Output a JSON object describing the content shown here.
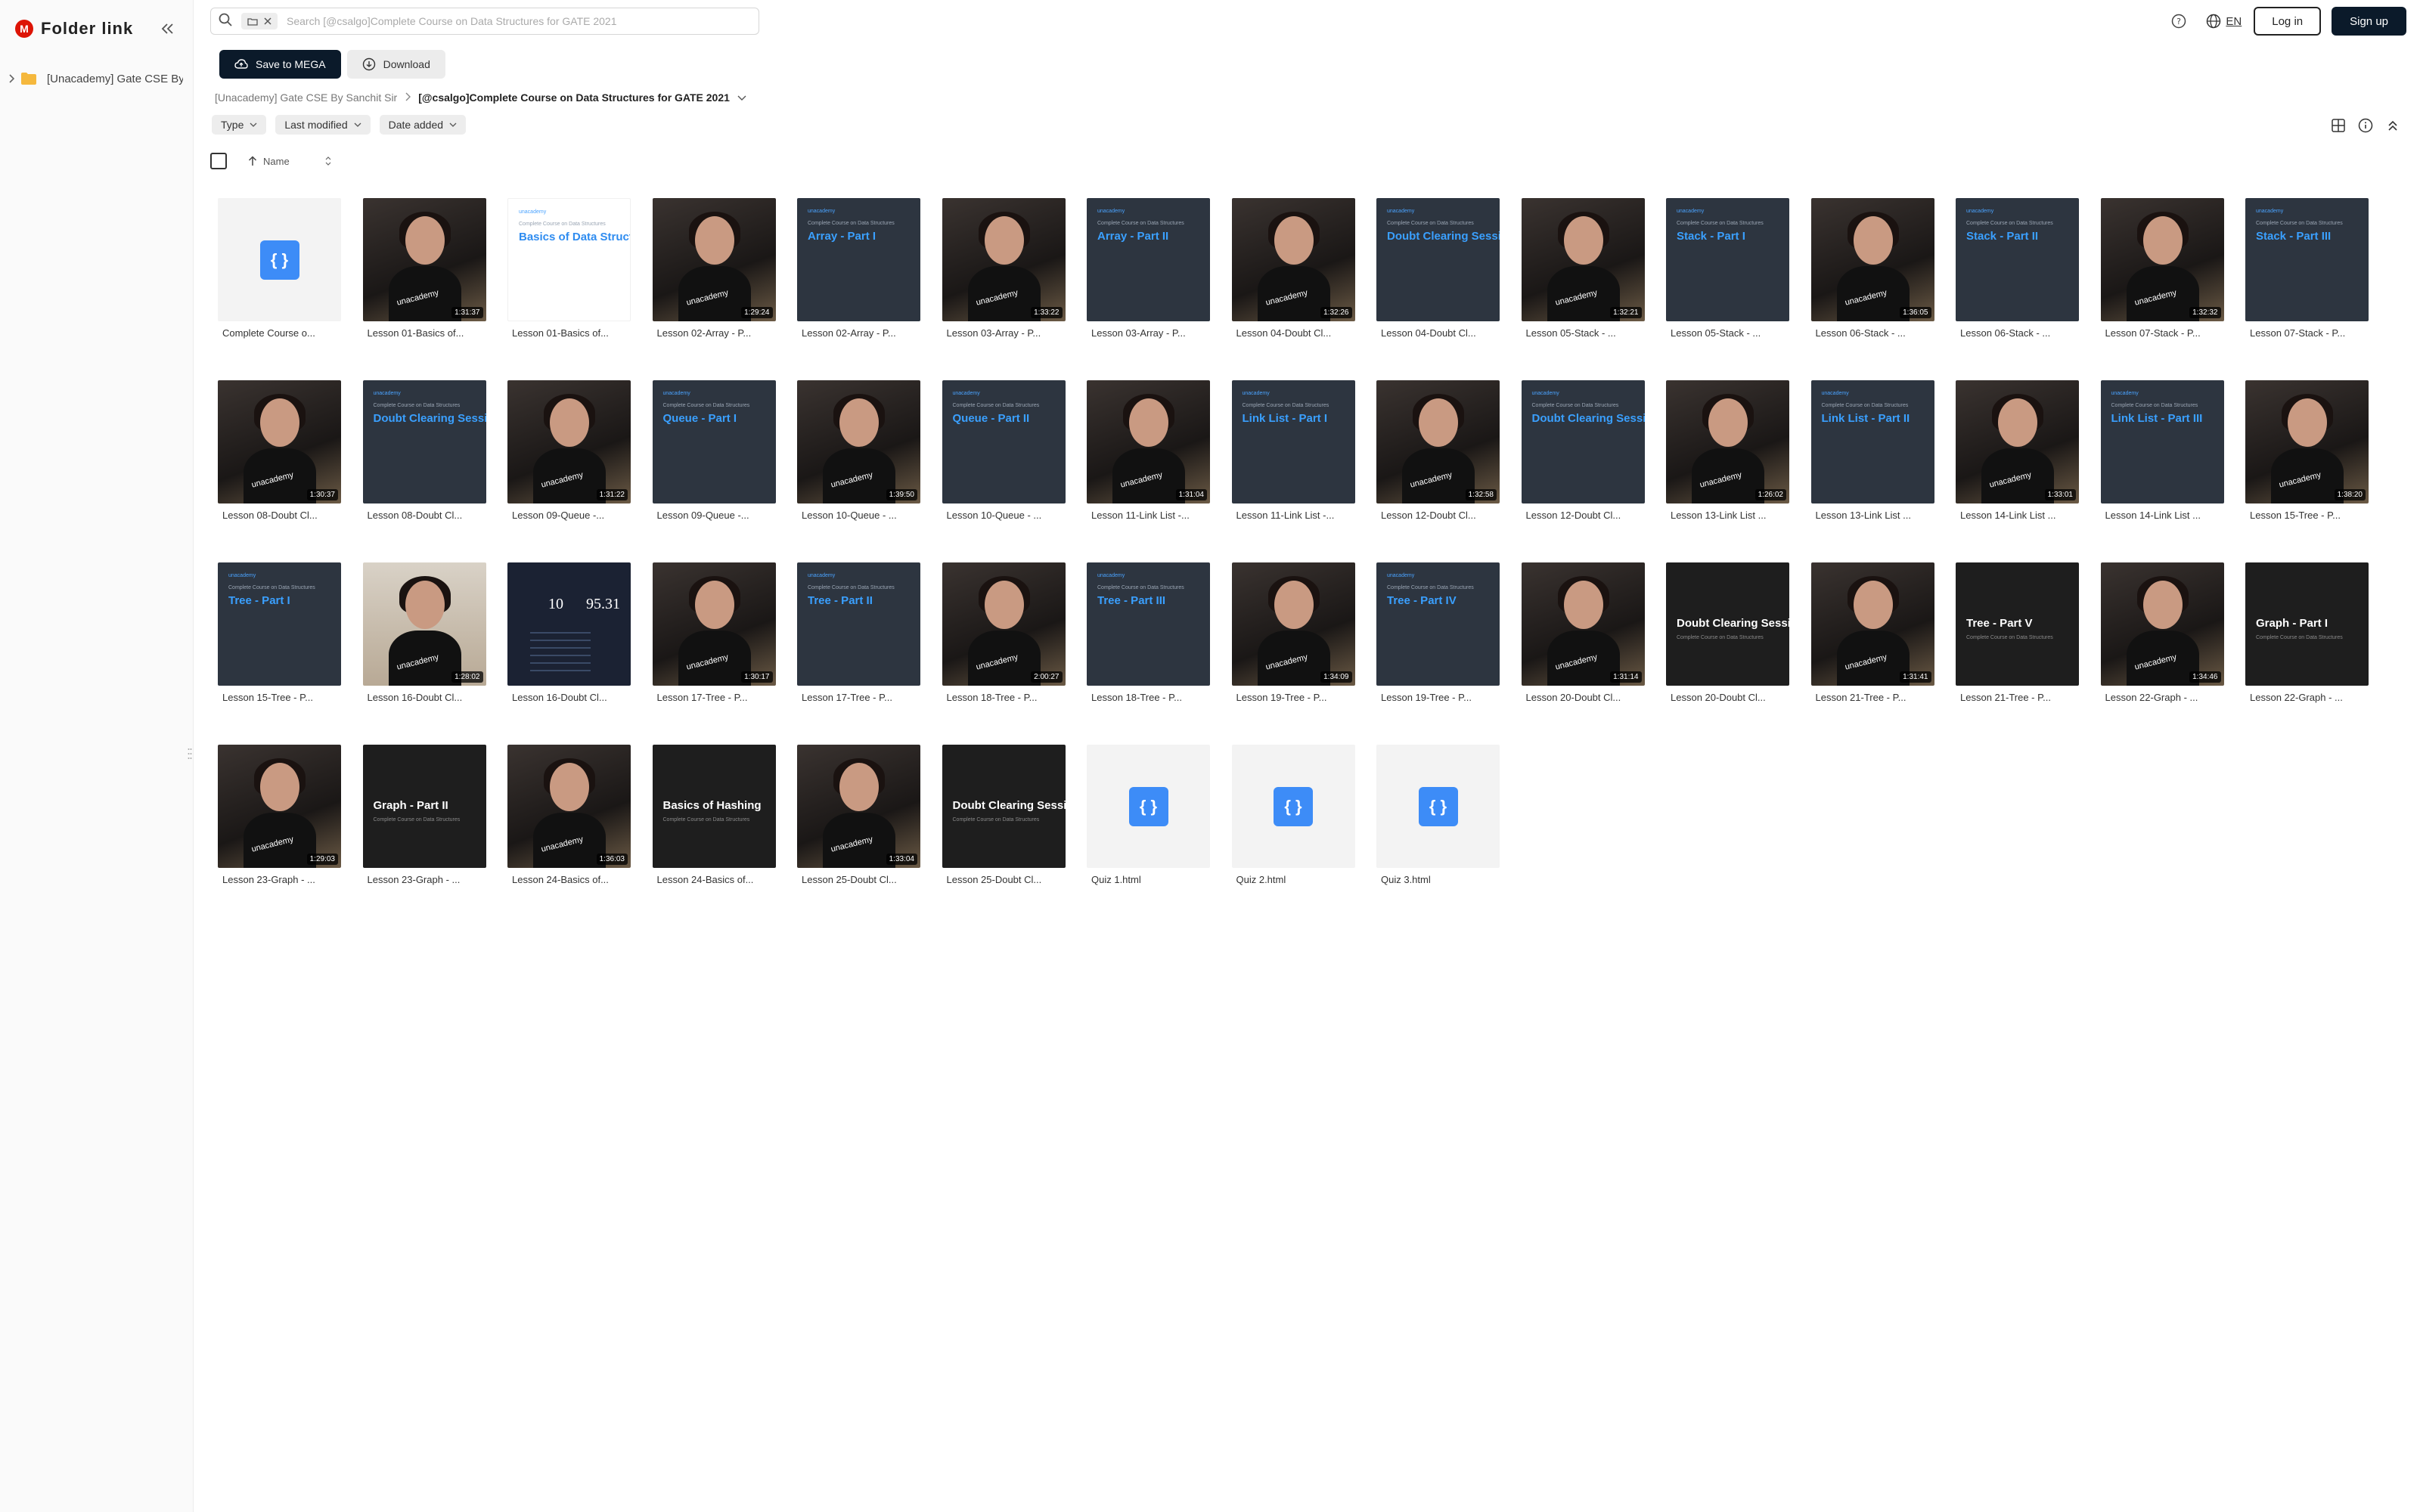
{
  "sidebar": {
    "brand": "Folder link",
    "tree": [
      {
        "label": "[Unacademy] Gate CSE By Sanchit Sir"
      }
    ]
  },
  "search": {
    "placeholder": "Search [@csalgo]Complete Course on Data Structures for GATE 2021"
  },
  "header": {
    "lang": "EN",
    "login": "Log in",
    "signup": "Sign up"
  },
  "actions": {
    "save": "Save to MEGA",
    "download": "Download"
  },
  "breadcrumb": {
    "parent": "[Unacademy] Gate CSE By Sanchit Sir",
    "current": "[@csalgo]Complete Course on Data Structures for GATE 2021"
  },
  "filters": [
    "Type",
    "Last modified",
    "Date added"
  ],
  "sort": {
    "label": "Name"
  },
  "files": [
    {
      "kind": "code",
      "name": "Complete Course o..."
    },
    {
      "kind": "video",
      "name": "Lesson 01-Basics of...",
      "duration": "1:31:37"
    },
    {
      "kind": "slide-light",
      "name": "Lesson 01-Basics of...",
      "title": "Basics of Data Structures"
    },
    {
      "kind": "video",
      "name": "Lesson 02-Array - P...",
      "duration": "1:29:24"
    },
    {
      "kind": "slide",
      "name": "Lesson 02-Array - P...",
      "title": "Array - Part I"
    },
    {
      "kind": "video",
      "name": "Lesson 03-Array - P...",
      "duration": "1:33:22"
    },
    {
      "kind": "slide",
      "name": "Lesson 03-Array - P...",
      "title": "Array - Part II"
    },
    {
      "kind": "video",
      "name": "Lesson 04-Doubt Cl...",
      "duration": "1:32:26"
    },
    {
      "kind": "slide",
      "name": "Lesson 04-Doubt Cl...",
      "title": "Doubt Clearing Session"
    },
    {
      "kind": "video",
      "name": "Lesson 05-Stack - ...",
      "duration": "1:32:21"
    },
    {
      "kind": "slide",
      "name": "Lesson 05-Stack - ...",
      "title": "Stack - Part I"
    },
    {
      "kind": "video",
      "name": "Lesson 06-Stack - ...",
      "duration": "1:36:05"
    },
    {
      "kind": "slide",
      "name": "Lesson 06-Stack - ...",
      "title": "Stack - Part II"
    },
    {
      "kind": "video",
      "name": "Lesson 07-Stack - P...",
      "duration": "1:32:32"
    },
    {
      "kind": "slide",
      "name": "Lesson 07-Stack - P...",
      "title": "Stack - Part III"
    },
    {
      "kind": "video",
      "name": "Lesson 08-Doubt Cl...",
      "duration": "1:30:37"
    },
    {
      "kind": "slide",
      "name": "Lesson 08-Doubt Cl...",
      "title": "Doubt Clearing Session"
    },
    {
      "kind": "video",
      "name": "Lesson 09-Queue -...",
      "duration": "1:31:22"
    },
    {
      "kind": "slide",
      "name": "Lesson 09-Queue -...",
      "title": "Queue - Part I"
    },
    {
      "kind": "video",
      "name": "Lesson 10-Queue - ...",
      "duration": "1:39:50"
    },
    {
      "kind": "slide",
      "name": "Lesson 10-Queue - ...",
      "title": "Queue - Part II"
    },
    {
      "kind": "video",
      "name": "Lesson 11-Link List -...",
      "duration": "1:31:04"
    },
    {
      "kind": "slide",
      "name": "Lesson 11-Link List -...",
      "title": "Link List - Part I"
    },
    {
      "kind": "video",
      "name": "Lesson 12-Doubt Cl...",
      "duration": "1:32:58"
    },
    {
      "kind": "slide",
      "name": "Lesson 12-Doubt Cl...",
      "title": "Doubt Clearing Session"
    },
    {
      "kind": "video",
      "name": "Lesson 13-Link List ...",
      "duration": "1:26:02"
    },
    {
      "kind": "slide",
      "name": "Lesson 13-Link List ...",
      "title": "Link List - Part II"
    },
    {
      "kind": "video",
      "name": "Lesson 14-Link List ...",
      "duration": "1:33:01"
    },
    {
      "kind": "slide",
      "name": "Lesson 14-Link List ...",
      "title": "Link List - Part III"
    },
    {
      "kind": "video",
      "name": "Lesson 15-Tree - P...",
      "duration": "1:38:20"
    },
    {
      "kind": "slide",
      "name": "Lesson 15-Tree - P...",
      "title": "Tree - Part I"
    },
    {
      "kind": "video2",
      "name": "Lesson 16-Doubt Cl...",
      "duration": "1:28:02"
    },
    {
      "kind": "speed",
      "name": "Lesson 16-Doubt Cl...",
      "v1": "10",
      "v2": "95.31"
    },
    {
      "kind": "video",
      "name": "Lesson 17-Tree - P...",
      "duration": "1:30:17"
    },
    {
      "kind": "slide",
      "name": "Lesson 17-Tree - P...",
      "title": "Tree - Part II"
    },
    {
      "kind": "video",
      "name": "Lesson 18-Tree - P...",
      "duration": "2:00:27"
    },
    {
      "kind": "slide",
      "name": "Lesson 18-Tree - P...",
      "title": "Tree - Part III"
    },
    {
      "kind": "video",
      "name": "Lesson 19-Tree - P...",
      "duration": "1:34:09"
    },
    {
      "kind": "slide",
      "name": "Lesson 19-Tree - P...",
      "title": "Tree - Part IV"
    },
    {
      "kind": "video",
      "name": "Lesson 20-Doubt Cl...",
      "duration": "1:31:14"
    },
    {
      "kind": "dark",
      "name": "Lesson 20-Doubt Cl...",
      "title": "Doubt Clearing Session"
    },
    {
      "kind": "video",
      "name": "Lesson 21-Tree - P...",
      "duration": "1:31:41"
    },
    {
      "kind": "dark",
      "name": "Lesson 21-Tree - P...",
      "title": "Tree - Part V"
    },
    {
      "kind": "video",
      "name": "Lesson 22-Graph - ...",
      "duration": "1:34:46"
    },
    {
      "kind": "dark",
      "name": "Lesson 22-Graph - ...",
      "title": "Graph - Part I"
    },
    {
      "kind": "video",
      "name": "Lesson 23-Graph - ...",
      "duration": "1:29:03"
    },
    {
      "kind": "dark",
      "name": "Lesson 23-Graph - ...",
      "title": "Graph - Part II"
    },
    {
      "kind": "video",
      "name": "Lesson 24-Basics of...",
      "duration": "1:36:03"
    },
    {
      "kind": "dark",
      "name": "Lesson 24-Basics of...",
      "title": "Basics of Hashing"
    },
    {
      "kind": "video",
      "name": "Lesson 25-Doubt Cl...",
      "duration": "1:33:04"
    },
    {
      "kind": "dark",
      "name": "Lesson 25-Doubt Cl...",
      "title": "Doubt Clearing Session"
    },
    {
      "kind": "code",
      "name": "Quiz 1.html"
    },
    {
      "kind": "code",
      "name": "Quiz 2.html"
    },
    {
      "kind": "code",
      "name": "Quiz 3.html"
    }
  ],
  "slide_text": {
    "brand": "unacademy",
    "subtitle": "Complete Course on Data Structures"
  },
  "colors": {
    "accent": "#0b1a2a",
    "code_icon": "#3d8cf7",
    "mega_red": "#dd1405"
  }
}
